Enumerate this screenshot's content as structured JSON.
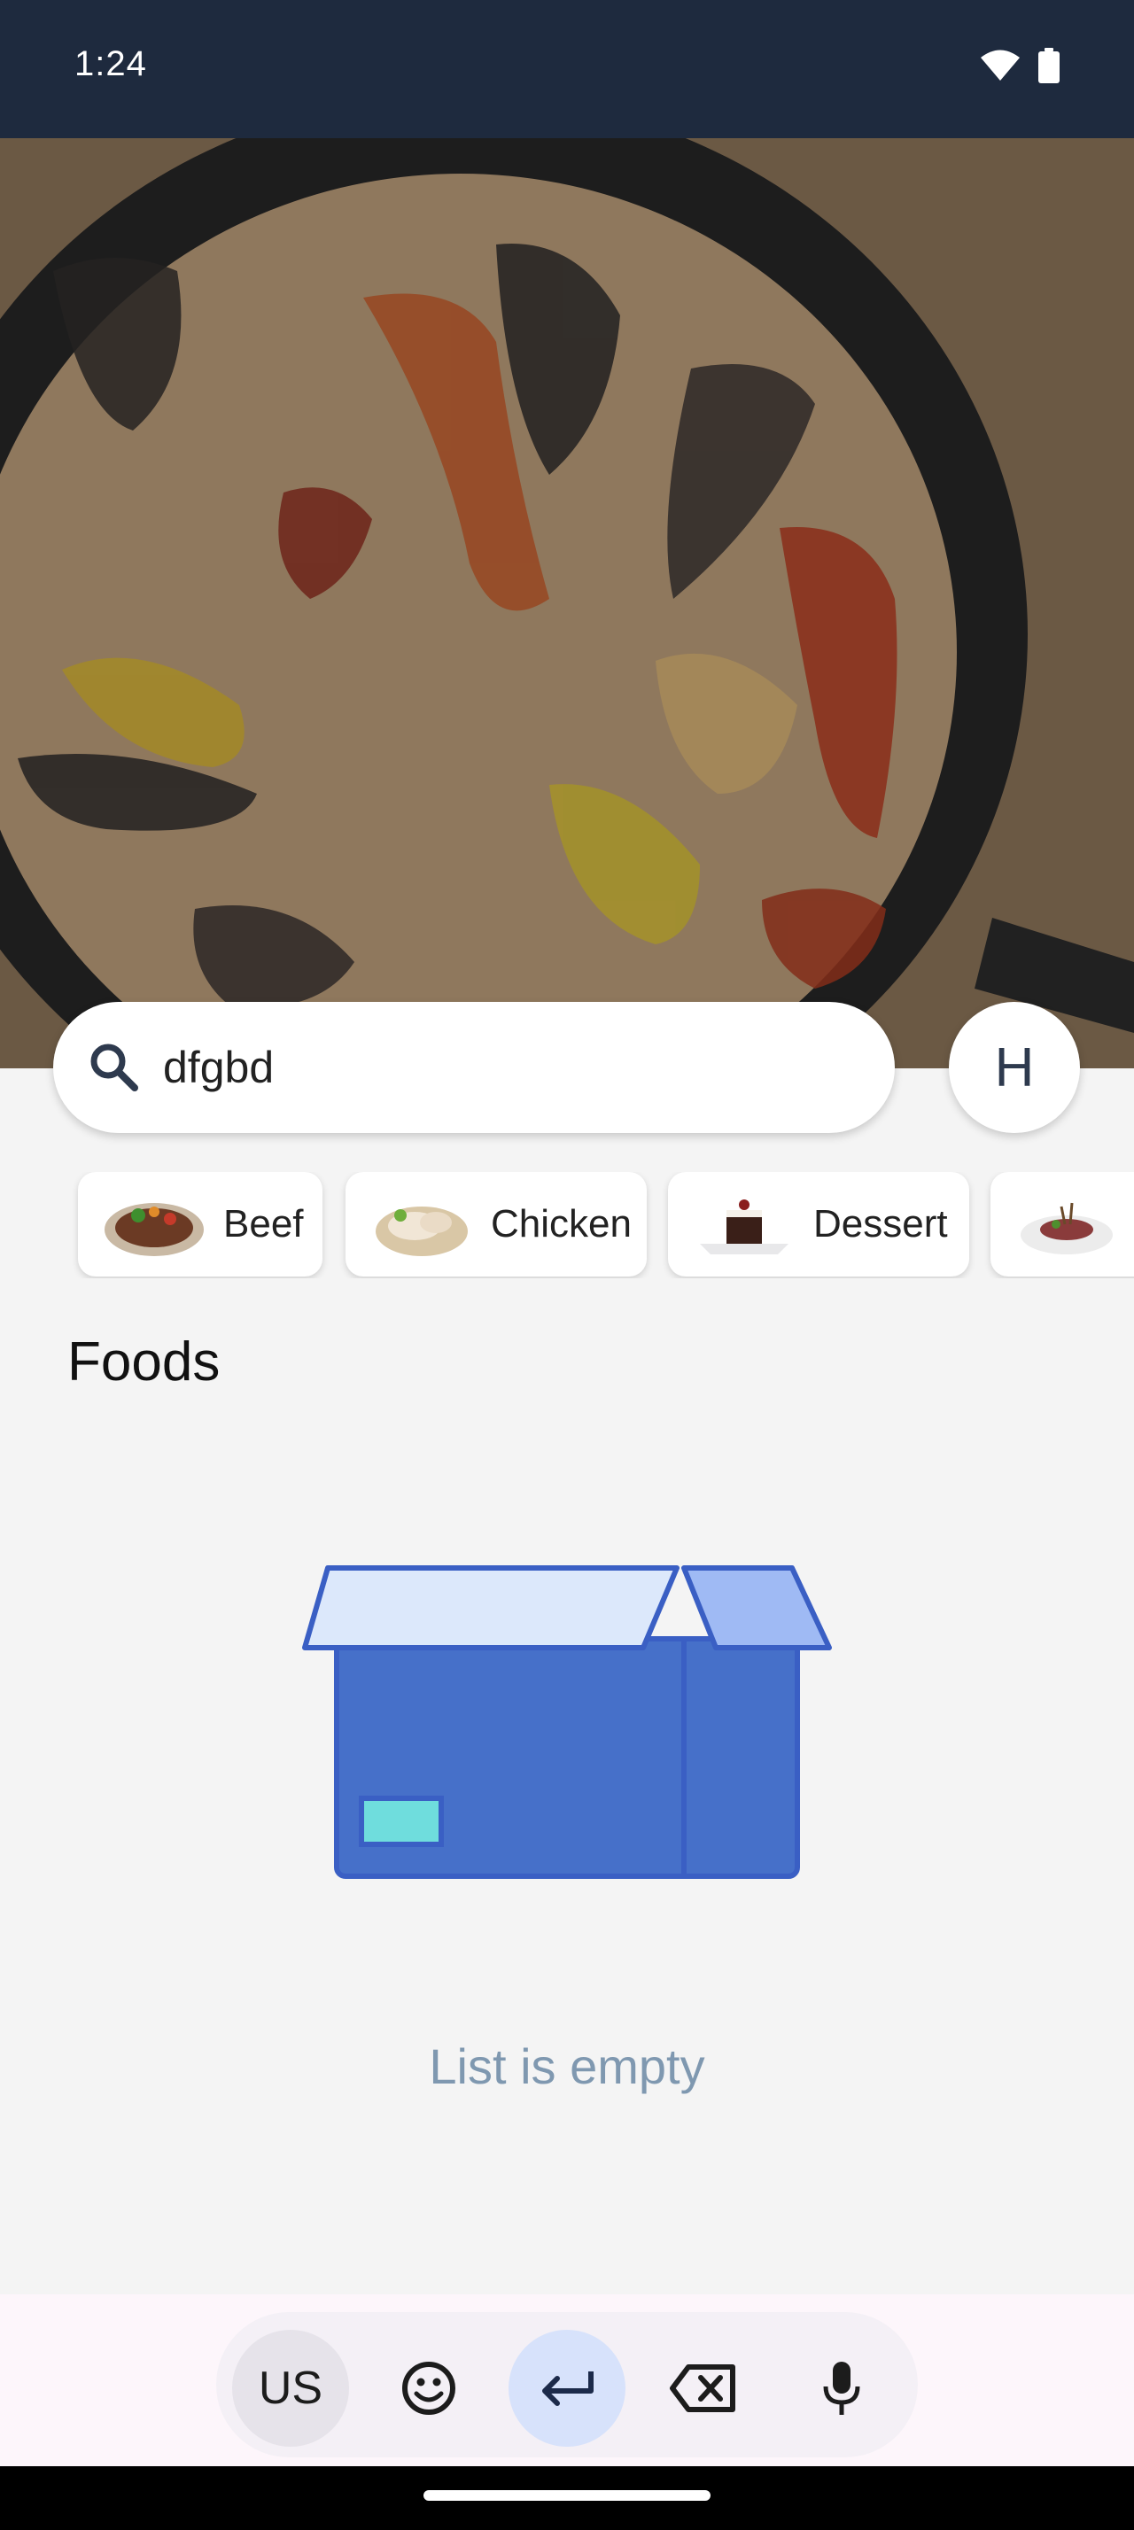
{
  "status_bar": {
    "time": "1:24",
    "icons": [
      "wifi-icon",
      "battery-icon"
    ]
  },
  "hero": {
    "image": "paella-pan-photo"
  },
  "search": {
    "value": "dfgbd",
    "icon": "search-icon"
  },
  "profile": {
    "initial": "H"
  },
  "categories": [
    {
      "label": "Beef",
      "image": "beef-dish"
    },
    {
      "label": "Chicken",
      "image": "chicken-dish"
    },
    {
      "label": "Dessert",
      "image": "dessert-dish"
    },
    {
      "label": "",
      "image": "lamb-dish"
    }
  ],
  "foods": {
    "title": "Foods",
    "empty_message": "List is empty",
    "empty_icon": "empty-box-icon"
  },
  "keyboard": {
    "language_label": "US",
    "keys": [
      "emoji-icon",
      "enter-icon",
      "backspace-icon",
      "microphone-icon"
    ]
  },
  "colors": {
    "status_bar": "#1e2a3e",
    "empty_text": "#7f98b0",
    "box_primary": "#4670c9",
    "box_lid": "#dce8fb",
    "box_label": "#6fdddd"
  }
}
